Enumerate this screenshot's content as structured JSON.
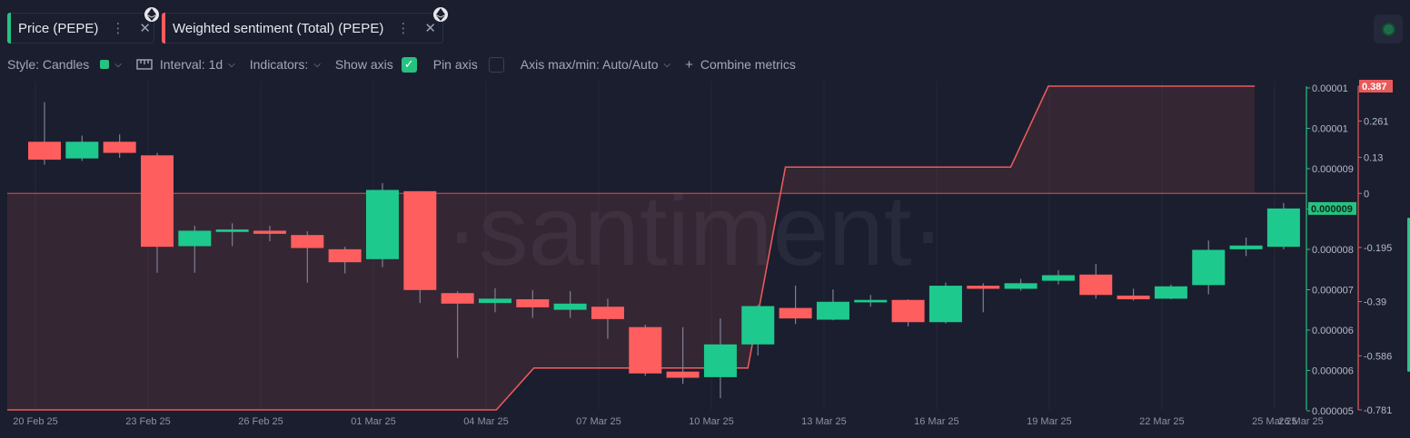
{
  "tabs": [
    {
      "label": "Price (PEPE)",
      "color": "#26c281",
      "dots": "⋮",
      "close": "✕"
    },
    {
      "label": "Weighted sentiment (Total) (PEPE)",
      "color": "#ff5b5b",
      "dots": "⋮",
      "close": "✕"
    }
  ],
  "toolbar": {
    "style_label": "Style: Candles",
    "style_color": "#26c281",
    "interval_label": "Interval: 1d",
    "indicators_label": "Indicators:",
    "show_axis_label": "Show axis",
    "show_axis_checked": true,
    "pin_axis_label": "Pin axis",
    "pin_axis_checked": false,
    "axis_label": "Axis max/min: Auto/Auto",
    "combine_plus": "+",
    "combine_label": "Combine metrics"
  },
  "chart_data": {
    "type": "candlestick",
    "watermark": "·santiment·",
    "x_labels": [
      "20 Feb 25",
      "23 Feb 25",
      "26 Feb 25",
      "01 Mar 25",
      "04 Mar 25",
      "07 Mar 25",
      "10 Mar 25",
      "13 Mar 25",
      "16 Mar 25",
      "19 Mar 25",
      "22 Mar 25",
      "25 Mar 25",
      "26 Mar 25"
    ],
    "price_axis": {
      "ticks": [
        "0.00001",
        "0.00001",
        "0.000009",
        "0.000008",
        "0.000008",
        "0.000007",
        "0.000006",
        "0.000006",
        "0.000005"
      ],
      "current_label": "0.000009",
      "min": 5.18e-06,
      "max": 1.042e-05,
      "color": "#26c281"
    },
    "sentiment_axis": {
      "ticks": [
        "0.387",
        "0.261",
        "0.13",
        "0",
        "-0.195",
        "-0.39",
        "-0.586",
        "-0.781"
      ],
      "tick_values": [
        0.387,
        0.261,
        0.13,
        0,
        -0.195,
        -0.39,
        -0.586,
        -0.781
      ],
      "current_label": "0.387",
      "min": -0.781,
      "max": 0.387,
      "color": "#e75a5a"
    },
    "candles": [
      {
        "o": 9.52e-06,
        "h": 1.016e-05,
        "l": 9.15e-06,
        "c": 9.23e-06
      },
      {
        "o": 9.25e-06,
        "h": 9.62e-06,
        "l": 9.21e-06,
        "c": 9.52e-06
      },
      {
        "o": 9.52e-06,
        "h": 9.64e-06,
        "l": 9.26e-06,
        "c": 9.34e-06
      },
      {
        "o": 9.3e-06,
        "h": 9.34e-06,
        "l": 7.4e-06,
        "c": 7.82e-06
      },
      {
        "o": 7.83e-06,
        "h": 8.16e-06,
        "l": 7.4e-06,
        "c": 8.08e-06
      },
      {
        "o": 8.06e-06,
        "h": 8.2e-06,
        "l": 7.83e-06,
        "c": 8.1e-06
      },
      {
        "o": 8.08e-06,
        "h": 8.16e-06,
        "l": 7.91e-06,
        "c": 8.03e-06
      },
      {
        "o": 8.01e-06,
        "h": 8.07e-06,
        "l": 7.24e-06,
        "c": 7.8e-06
      },
      {
        "o": 7.78e-06,
        "h": 7.82e-06,
        "l": 7.39e-06,
        "c": 7.57e-06
      },
      {
        "o": 7.62e-06,
        "h": 8.85e-06,
        "l": 7.49e-06,
        "c": 8.74e-06
      },
      {
        "o": 8.72e-06,
        "h": 8.72e-06,
        "l": 6.91e-06,
        "c": 7.12e-06
      },
      {
        "o": 7.07e-06,
        "h": 7.1e-06,
        "l": 6.02e-06,
        "c": 6.9e-06
      },
      {
        "o": 6.91e-06,
        "h": 7.15e-06,
        "l": 6.76e-06,
        "c": 6.98e-06
      },
      {
        "o": 6.97e-06,
        "h": 7.12e-06,
        "l": 6.67e-06,
        "c": 6.84e-06
      },
      {
        "o": 6.8e-06,
        "h": 7.1e-06,
        "l": 6.67e-06,
        "c": 6.9e-06
      },
      {
        "o": 6.85e-06,
        "h": 6.98e-06,
        "l": 6.33e-06,
        "c": 6.65e-06
      },
      {
        "o": 6.52e-06,
        "h": 6.56e-06,
        "l": 5.73e-06,
        "c": 5.77e-06
      },
      {
        "o": 5.8e-06,
        "h": 6.52e-06,
        "l": 5.6e-06,
        "c": 5.7e-06
      },
      {
        "o": 5.71e-06,
        "h": 6.66e-06,
        "l": 5.37e-06,
        "c": 6.24e-06
      },
      {
        "o": 6.24e-06,
        "h": 6.88e-06,
        "l": 6.06e-06,
        "c": 6.86e-06
      },
      {
        "o": 6.83e-06,
        "h": 7.19e-06,
        "l": 6.57e-06,
        "c": 6.66e-06
      },
      {
        "o": 6.64e-06,
        "h": 7.13e-06,
        "l": 6.63e-06,
        "c": 6.93e-06
      },
      {
        "o": 6.92e-06,
        "h": 7.04e-06,
        "l": 6.85e-06,
        "c": 6.96e-06
      },
      {
        "o": 6.96e-06,
        "h": 6.97e-06,
        "l": 6.53e-06,
        "c": 6.6e-06
      },
      {
        "o": 6.6e-06,
        "h": 7.24e-06,
        "l": 6.58e-06,
        "c": 7.19e-06
      },
      {
        "o": 7.19e-06,
        "h": 7.23e-06,
        "l": 6.76e-06,
        "c": 7.14e-06
      },
      {
        "o": 7.14e-06,
        "h": 7.3e-06,
        "l": 7.11e-06,
        "c": 7.23e-06
      },
      {
        "o": 7.27e-06,
        "h": 7.44e-06,
        "l": 7.21e-06,
        "c": 7.36e-06
      },
      {
        "o": 7.37e-06,
        "h": 7.54e-06,
        "l": 6.98e-06,
        "c": 7.04e-06
      },
      {
        "o": 7.03e-06,
        "h": 7.14e-06,
        "l": 6.95e-06,
        "c": 6.97e-06
      },
      {
        "o": 6.98e-06,
        "h": 7.21e-06,
        "l": 6.97e-06,
        "c": 7.18e-06
      },
      {
        "o": 7.2e-06,
        "h": 7.92e-06,
        "l": 7.05e-06,
        "c": 7.77e-06
      },
      {
        "o": 7.78e-06,
        "h": 7.97e-06,
        "l": 7.67e-06,
        "c": 7.84e-06
      },
      {
        "o": 7.82e-06,
        "h": 8.53e-06,
        "l": 7.78e-06,
        "c": 8.44e-06
      }
    ],
    "sentiment_line": [
      {
        "day": 0,
        "v": -0.781
      },
      {
        "day": 13,
        "v": -0.781
      },
      {
        "day": 14,
        "v": -0.63
      },
      {
        "day": 19.7,
        "v": -0.63
      },
      {
        "day": 20.7,
        "v": 0.095
      },
      {
        "day": 26.7,
        "v": 0.095
      },
      {
        "day": 27.7,
        "v": 0.387
      },
      {
        "day": 33.2,
        "v": 0.387
      }
    ]
  }
}
